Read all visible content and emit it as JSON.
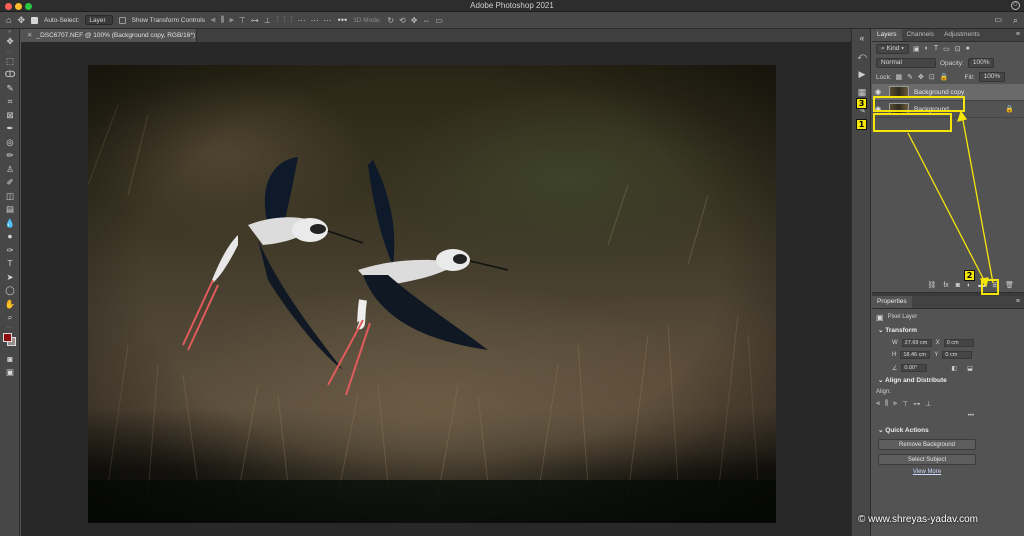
{
  "app": {
    "title": "Adobe Photoshop 2021"
  },
  "options_bar": {
    "auto_select_label": "Auto-Select:",
    "auto_select_value": "Layer",
    "show_transform_label": "Show Transform Controls",
    "mode_3d_label": "3D Mode:"
  },
  "document": {
    "tab_title": "_DSC6707.NEF @ 100% (Background copy, RGB/16*) *"
  },
  "layers_panel": {
    "tabs": [
      "Layers",
      "Channels",
      "Adjustments"
    ],
    "filter_kind": "Kind",
    "blend_mode": "Normal",
    "opacity_label": "Opacity:",
    "opacity_value": "100%",
    "lock_label": "Lock:",
    "fill_label": "Fill:",
    "fill_value": "100%",
    "layers": [
      {
        "name": "Background copy",
        "selected": true,
        "visible": true
      },
      {
        "name": "Background",
        "selected": false,
        "visible": true,
        "locked": true
      }
    ]
  },
  "annotations": {
    "badges": [
      "3",
      "1",
      "2"
    ],
    "color": "#f5e60a"
  },
  "properties_panel": {
    "title": "Properties",
    "layer_type": "Pixel Layer",
    "transform_title": "Transform",
    "w_label": "W",
    "w_value": "27.69 cm",
    "h_label": "H",
    "h_value": "18.46 cm",
    "x_label": "X",
    "x_value": "0 cm",
    "y_label": "Y",
    "y_value": "0 cm",
    "angle_value": "0.00°",
    "align_title": "Align and Distribute",
    "align_label": "Align:",
    "quick_actions_title": "Quick Actions",
    "remove_bg": "Remove Background",
    "select_subject": "Select Subject",
    "view_more": "View More"
  },
  "watermark": "© www.shreyas-yadav.com",
  "icons": [
    "home-icon",
    "move-icon",
    "search-icon",
    "workspace-icon",
    "eye-icon",
    "lock-icon",
    "new-layer-icon",
    "trash-icon",
    "fx-icon",
    "mask-icon",
    "folder-icon",
    "link-icon"
  ]
}
